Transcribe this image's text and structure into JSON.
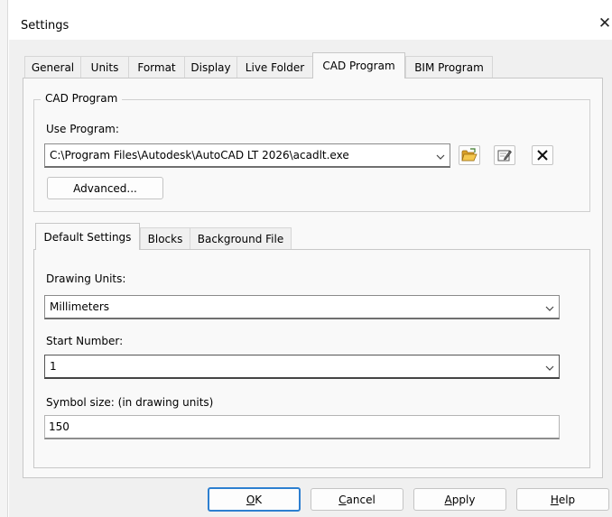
{
  "window": {
    "title": "Settings",
    "close_glyph": "✕"
  },
  "tabs": [
    {
      "label": "General"
    },
    {
      "label": "Units"
    },
    {
      "label": "Format"
    },
    {
      "label": "Display"
    },
    {
      "label": "Live Folder"
    },
    {
      "label": "CAD Program",
      "active": true
    },
    {
      "label": "BIM Program"
    }
  ],
  "cad_program": {
    "group_title": "CAD Program",
    "use_program_label": "Use Program:",
    "program_path": "C:\\Program Files\\Autodesk\\AutoCAD LT 2026\\acadlt.exe",
    "browse_icon": "folder-open-icon",
    "edit_icon": "edit-icon",
    "clear_icon": "delete-x-icon",
    "advanced_label": "Advanced..."
  },
  "subtabs": [
    {
      "label": "Default Settings",
      "active": true
    },
    {
      "label": "Blocks"
    },
    {
      "label": "Background File"
    }
  ],
  "default_settings": {
    "drawing_units_label": "Drawing Units:",
    "drawing_units_value": "Millimeters",
    "start_number_label": "Start Number:",
    "start_number_value": "1",
    "symbol_size_label": "Symbol size: (in drawing units)",
    "symbol_size_value": "150"
  },
  "buttons": {
    "ok": {
      "mnemonic": "O",
      "rest": "K"
    },
    "cancel": {
      "mnemonic": "C",
      "rest": "ancel"
    },
    "apply": {
      "mnemonic": "A",
      "rest": "pply"
    },
    "help": {
      "mnemonic": "H",
      "rest": "elp"
    }
  },
  "colors": {
    "accent": "#2d7fd0",
    "folder": "#e8b43c",
    "dialog_bg": "#f0f0f0"
  }
}
